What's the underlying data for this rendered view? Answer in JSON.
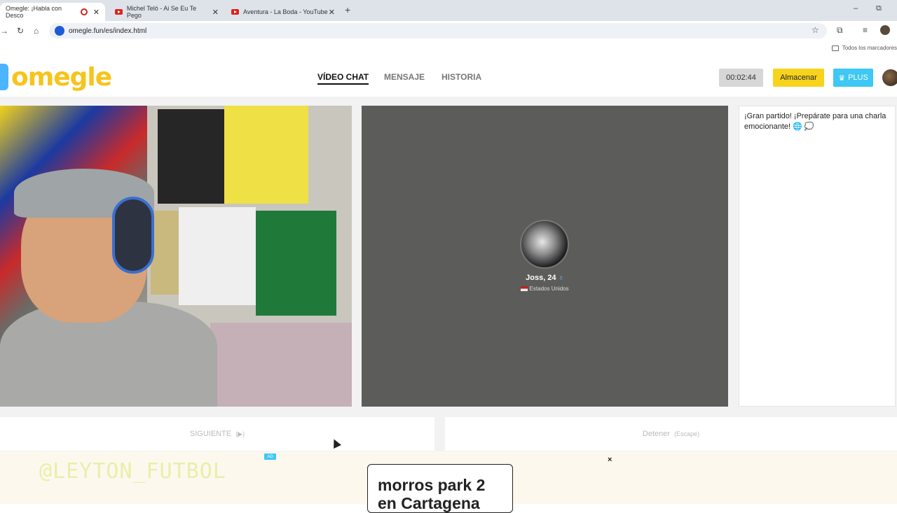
{
  "browser": {
    "tabs": [
      {
        "title": "Omegle: ¡Habla con Desco",
        "active": true
      },
      {
        "title": "Michel Teló - Ai Se Eu Te Pego",
        "active": false
      },
      {
        "title": "Aventura - La Boda - YouTube",
        "active": false
      }
    ],
    "new_tab": "+",
    "minimize": "–",
    "restore": "⧉",
    "url": "omegle.fun/es/index.html",
    "bookmarks_label": "Todos los marcadores"
  },
  "site": {
    "logo_text": "omegle",
    "nav": [
      {
        "label": "VÍDEO CHAT",
        "active": true
      },
      {
        "label": "MENSAJE",
        "active": false
      },
      {
        "label": "HISTORIA",
        "active": false
      }
    ],
    "timer": "00:02:44",
    "store_label": "Almacenar",
    "plus_label": "PLUS"
  },
  "stranger": {
    "name": "Joss, 24",
    "country": "Estados Unidos"
  },
  "chat": {
    "message": "¡Gran partido! ¡Prepárate para una charla emocionante! 🌐 💭"
  },
  "controls": {
    "next_label": "SIGUIENTE",
    "next_hint": "(▶)",
    "stop_label": "Detener",
    "stop_hint": "(Escape)"
  },
  "ad": {
    "tag": "AD",
    "text": "morros park 2 en Cartagena",
    "close": "×"
  },
  "overlay": {
    "watermark": "@LEYTON_FUTBOL"
  },
  "colors": {
    "logo_yellow": "#f7c41b",
    "logo_blue": "#4db5ff",
    "store_yellow": "#f7d31d",
    "plus_blue": "#3ec8f3"
  }
}
